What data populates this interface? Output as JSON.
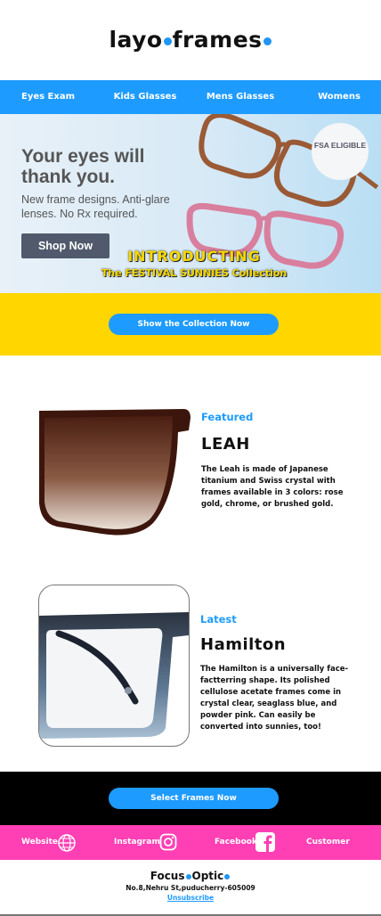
{
  "brand": {
    "logo_part1": "layo",
    "logo_part2": "frames"
  },
  "nav": {
    "items": [
      "Eyes Exam",
      "Kids Glasses",
      "Mens Glasses",
      "Womens Glasses"
    ]
  },
  "hero": {
    "headline": "Your eyes will thank you.",
    "subtext": "New frame designs. Anti-glare lenses. No Rx required.",
    "cta": "Shop Now",
    "badge": "FSA ELIGIBLE",
    "overlay_title": "INTRODUCTING",
    "overlay_subtitle": "The FESTIVAL SUNNIES Collection"
  },
  "collection_button": "Show the Collection Now",
  "products": [
    {
      "category": "Featured",
      "name": "LEAH",
      "description": "The Leah is made of Japanese titanium and Swiss crystal with frames available in 3 colors: rose gold, chrome, or brushed gold."
    },
    {
      "category": "Latest",
      "name": "Hamilton",
      "description": "The Hamilton is a universally face-factterring shape. Its polished cellulose acetate frames come in crystal clear, seaglass blue, and powder pink. Can easily be converted into sunnies, too!"
    }
  ],
  "select_button": "Select Frames Now",
  "social": {
    "website": "Website",
    "instagram": "Instagram",
    "facebook": "Facebook",
    "customer_service": "Customer Service"
  },
  "footer": {
    "logo_part1": "Focus",
    "logo_part2": "Optic",
    "address": "No.8,Nehru St,puducherry-605009",
    "unsubscribe": "Unsubscribe"
  },
  "colors": {
    "accent": "#1e9bff",
    "yellow": "#ffd600",
    "social_bg": "#ff3fb4",
    "black": "#000000"
  }
}
